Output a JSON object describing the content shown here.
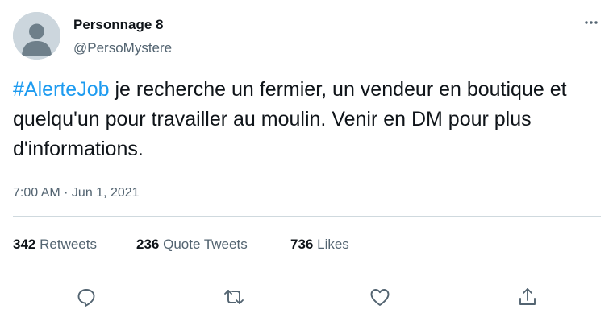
{
  "author": {
    "display_name": "Personnage 8",
    "handle": "@PersoMystere"
  },
  "tweet": {
    "hashtag": "#AlerteJob",
    "text": " je recherche un fermier, un vendeur en boutique et quelqu'un pour travailler au moulin. Venir en DM pour plus d'informations.",
    "time": "7:00 AM",
    "separator": " · ",
    "date": "Jun 1, 2021"
  },
  "stats": {
    "retweets": {
      "count": "342",
      "label": "Retweets"
    },
    "quote_tweets": {
      "count": "236",
      "label": "Quote Tweets"
    },
    "likes": {
      "count": "736",
      "label": "Likes"
    }
  },
  "icons": {
    "more": "more-horizontal-icon",
    "reply": "reply-icon",
    "retweet": "retweet-icon",
    "like": "heart-icon",
    "share": "share-icon"
  },
  "colors": {
    "accent": "#1d9bf0",
    "secondary_text": "#536471",
    "divider": "#cfd9de",
    "avatar_bg": "#ccd6dd",
    "avatar_fg": "#8a9aa4"
  }
}
